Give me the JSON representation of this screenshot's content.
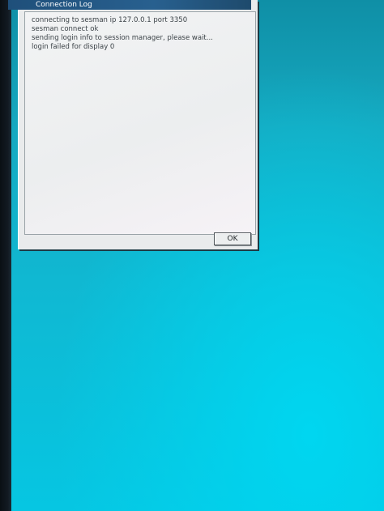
{
  "window": {
    "title": "Connection Log"
  },
  "log": {
    "lines": [
      "connecting to sesman ip 127.0.0.1 port 3350",
      "sesman connect ok",
      "sending login info to session manager, please wait...",
      "login failed for display 0"
    ]
  },
  "buttons": {
    "ok_label": "OK"
  },
  "colors": {
    "desktop": "#0fb8d2",
    "titlebar": "#245a87",
    "window": "#e9ebec"
  }
}
